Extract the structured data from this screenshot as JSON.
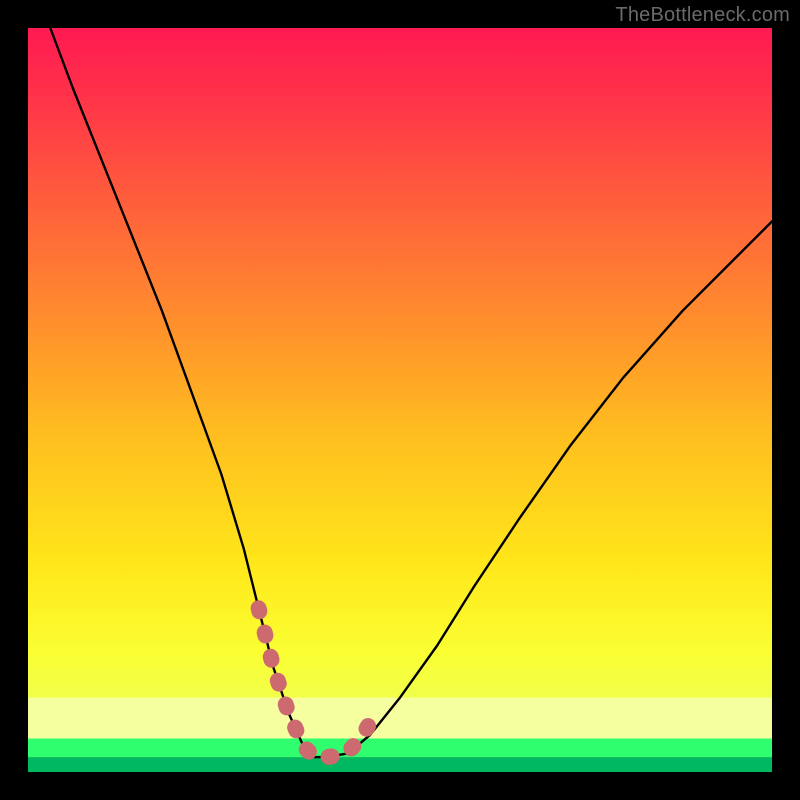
{
  "attribution": "TheBottleneck.com",
  "chart_data": {
    "type": "line",
    "title": "",
    "xlabel": "",
    "ylabel": "",
    "xlim": [
      0,
      100
    ],
    "ylim": [
      0,
      100
    ],
    "series": [
      {
        "name": "bottleneck-curve",
        "x": [
          3,
          6,
          10,
          14,
          18,
          22,
          26,
          29,
          31,
          33,
          35,
          37,
          38.5,
          40,
          43,
          46,
          50,
          55,
          60,
          66,
          73,
          80,
          88,
          96,
          100
        ],
        "values": [
          100,
          92,
          82,
          72,
          62,
          51,
          40,
          30,
          22,
          14,
          8,
          3.5,
          2,
          2,
          2.5,
          5,
          10,
          17,
          25,
          34,
          44,
          53,
          62,
          70,
          74
        ]
      },
      {
        "name": "highlight-segment",
        "x": [
          31,
          33,
          35,
          37,
          38.5,
          40,
          42,
          43.5,
          45,
          46.5
        ],
        "values": [
          22,
          14,
          8,
          3.5,
          2,
          2,
          2.2,
          3.2,
          5,
          7.5
        ]
      }
    ],
    "background_bands": [
      {
        "name": "pale-yellow-band",
        "y_from": 10,
        "y_to": 4.5,
        "color": "#f6ffa0"
      },
      {
        "name": "bright-green-band",
        "y_from": 4.5,
        "y_to": 2.0,
        "color": "#2fff6e"
      },
      {
        "name": "deep-green-band",
        "y_from": 2.0,
        "y_to": 0,
        "color": "#00b860"
      }
    ],
    "colors": {
      "curve": "#000000",
      "highlight": "#cc6a6f"
    }
  }
}
